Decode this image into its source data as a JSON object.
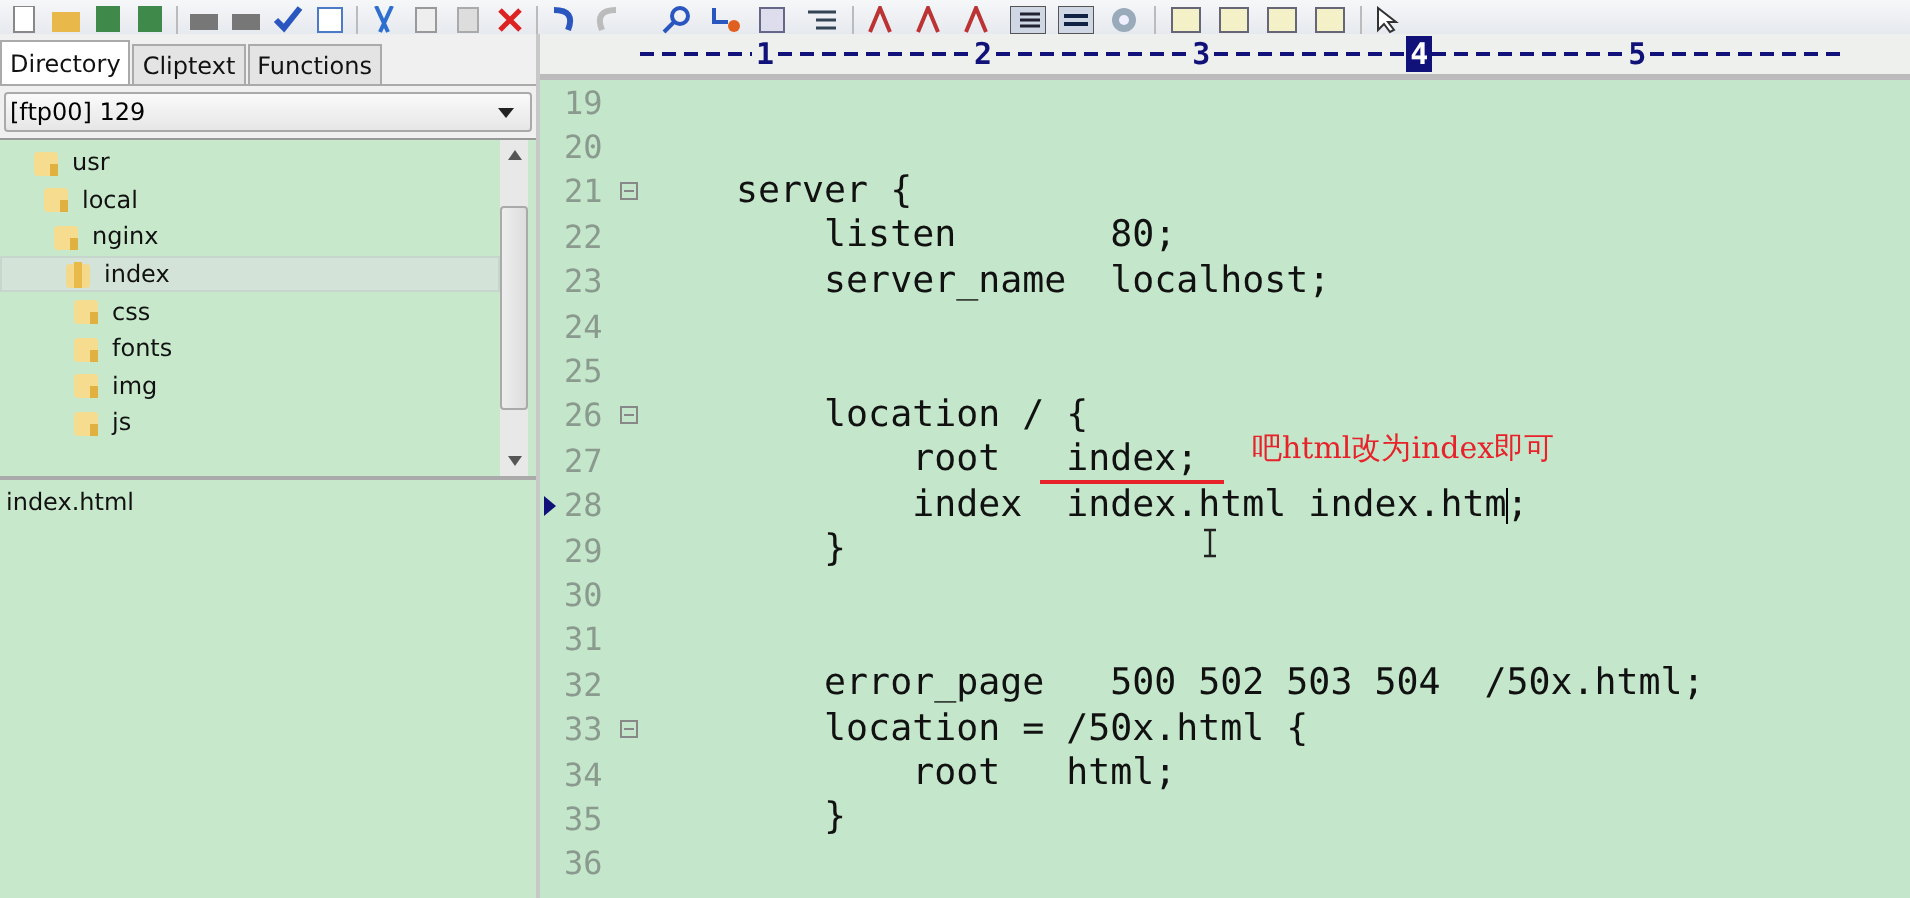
{
  "tabs": [
    {
      "label": "Directory",
      "selected": true
    },
    {
      "label": "Cliptext",
      "selected": false
    },
    {
      "label": "Functions",
      "selected": false
    }
  ],
  "drive_select": {
    "value": "[ftp00] 129"
  },
  "tree": [
    {
      "label": "usr",
      "selected": false,
      "children": [
        {
          "label": "local",
          "selected": false,
          "children": [
            {
              "label": "nginx",
              "selected": false,
              "children": [
                {
                  "label": "index",
                  "selected": true,
                  "children": [
                    {
                      "label": "css",
                      "selected": false
                    },
                    {
                      "label": "fonts",
                      "selected": false
                    },
                    {
                      "label": "img",
                      "selected": false
                    },
                    {
                      "label": "js",
                      "selected": false
                    }
                  ]
                }
              ]
            }
          ]
        }
      ]
    }
  ],
  "files": [
    {
      "label": "index.html"
    }
  ],
  "ruler": {
    "marks": [
      {
        "label": "1",
        "selected": false
      },
      {
        "label": "2",
        "selected": false
      },
      {
        "label": "3",
        "selected": false
      },
      {
        "label": "4",
        "selected": true
      },
      {
        "label": "5",
        "selected": false
      }
    ]
  },
  "lines": [
    {
      "number": "19",
      "fold": false,
      "current": false
    },
    {
      "number": "20",
      "fold": false,
      "current": false
    },
    {
      "number": "21",
      "text": "    server {",
      "fold": true,
      "current": false
    },
    {
      "number": "22",
      "text": "        listen       80;",
      "fold": false,
      "current": false
    },
    {
      "number": "23",
      "text": "        server_name  localhost;",
      "fold": false,
      "current": false
    },
    {
      "number": "24",
      "fold": false,
      "current": false
    },
    {
      "number": "25",
      "fold": false,
      "current": false
    },
    {
      "number": "26",
      "text": "        location / {",
      "fold": true,
      "current": false
    },
    {
      "number": "27",
      "text": "            root   index;",
      "fold": false,
      "current": false
    },
    {
      "number": "28",
      "text": "            index  index.html index.htm;",
      "fold": false,
      "current": true
    },
    {
      "number": "29",
      "text": "        }",
      "fold": false,
      "current": false
    },
    {
      "number": "30",
      "fold": false,
      "current": false
    },
    {
      "number": "31",
      "fold": false,
      "current": false
    },
    {
      "number": "32",
      "text": "        error_page   500 502 503 504  /50x.html;",
      "fold": false,
      "current": false
    },
    {
      "number": "33",
      "text": "        location = /50x.html {",
      "fold": true,
      "current": false
    },
    {
      "number": "34",
      "text": "            root   html;",
      "fold": false,
      "current": false
    },
    {
      "number": "35",
      "text": "        }",
      "fold": false,
      "current": false
    },
    {
      "number": "36",
      "fold": false,
      "current": false
    }
  ],
  "annotation": {
    "text": "吧html改为index即可"
  }
}
